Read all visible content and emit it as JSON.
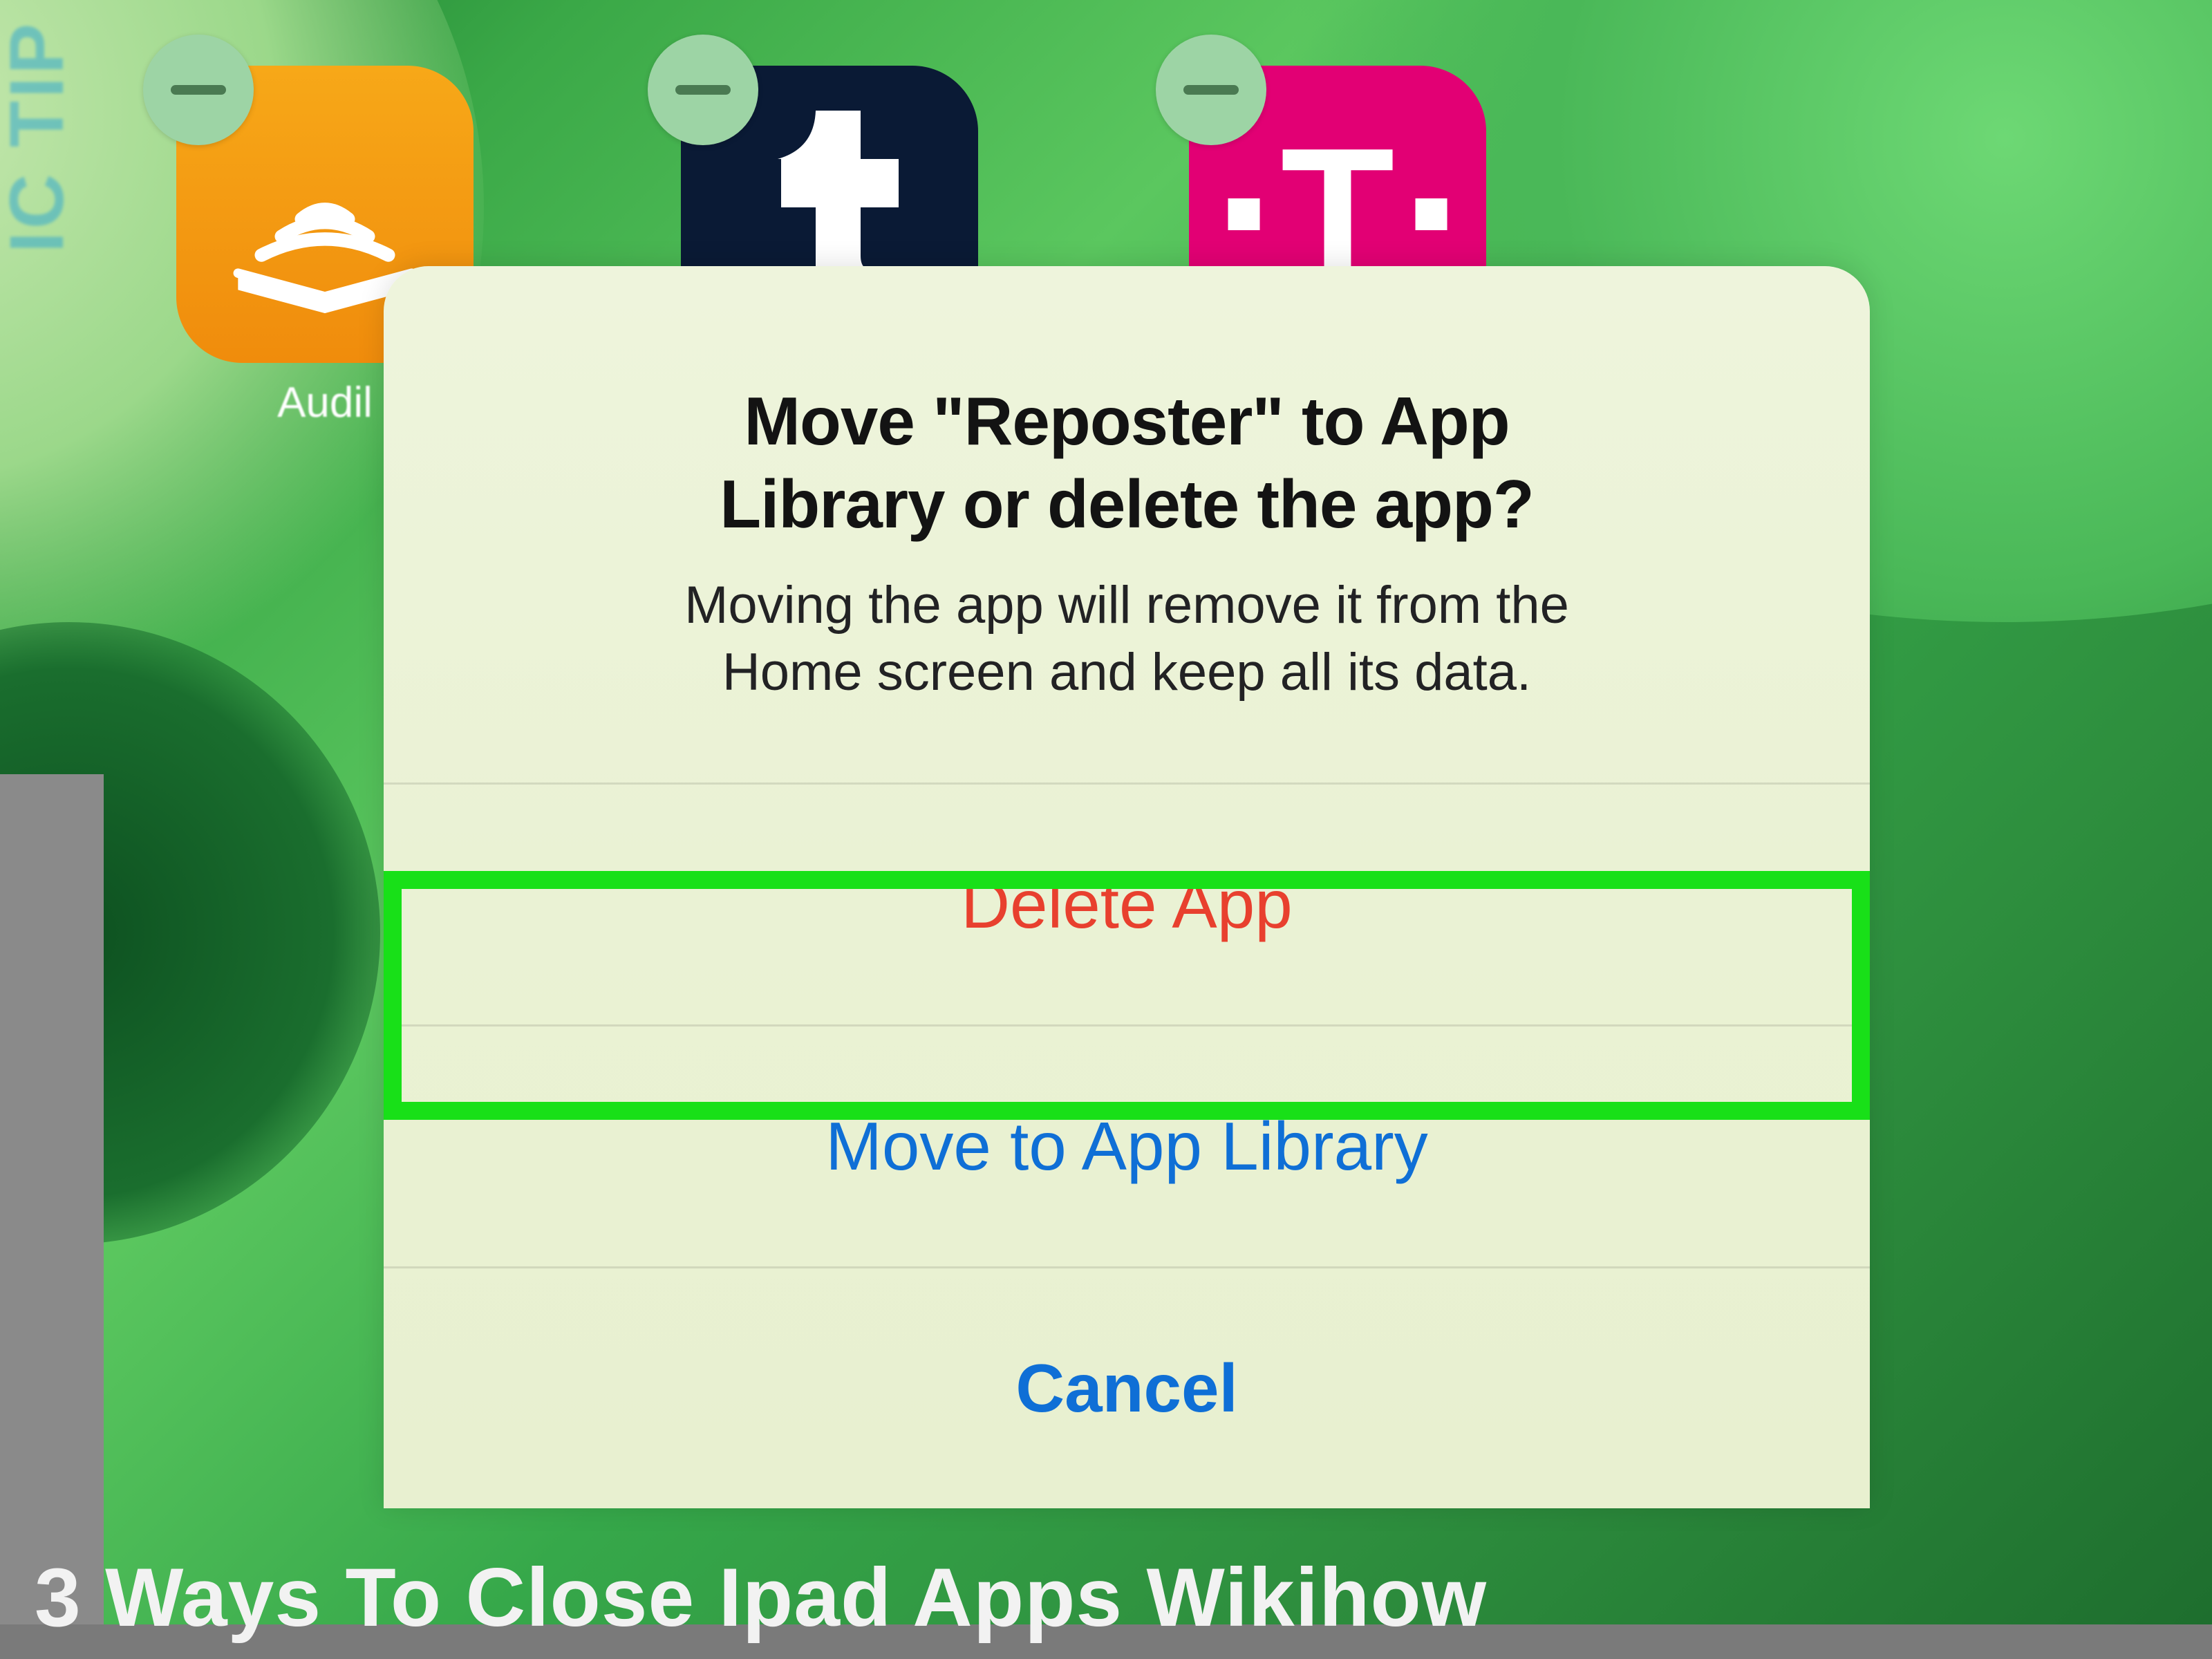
{
  "background": {
    "apps": [
      {
        "name": "audible",
        "label": "Audil"
      },
      {
        "name": "tumblr",
        "label": ""
      },
      {
        "name": "tmobile",
        "label": ""
      }
    ],
    "vertical_text": "IC TIP"
  },
  "alert": {
    "title_line1": "Move \"Reposter\" to App",
    "title_line2": "Library or delete the app?",
    "subtitle_line1": "Moving the app will remove it from the",
    "subtitle_line2": "Home screen and keep all its data.",
    "buttons": {
      "delete": "Delete App",
      "move": "Move to App Library",
      "cancel": "Cancel"
    }
  },
  "caption": "3 Ways To Close Ipad Apps Wikihow"
}
